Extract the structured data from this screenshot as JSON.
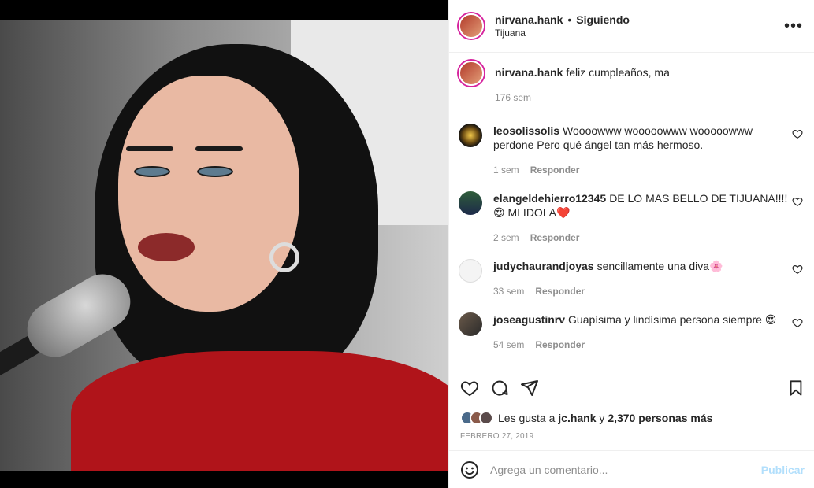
{
  "post": {
    "author": "nirvana.hank",
    "follow_status": "Siguiendo",
    "location": "Tijuana",
    "more_icon": "more-horizontal-icon"
  },
  "caption": {
    "user": "nirvana.hank",
    "text": "feliz cumpleaños, ma",
    "time": "176 sem"
  },
  "comments": [
    {
      "user": "leosolissolis",
      "text": "Woooowww wooooowww wooooowww perdone Pero qué ángel tan más hermoso.",
      "time": "1 sem",
      "reply": "Responder"
    },
    {
      "user": "elangeldehierro12345",
      "text": "DE LO MAS BELLO DE TIJUANA!!!! 😍 MI IDOLA❤️",
      "time": "2 sem",
      "reply": "Responder"
    },
    {
      "user": "judychaurandjoyas",
      "text": "sencillamente una diva🌸",
      "time": "33 sem",
      "reply": "Responder"
    },
    {
      "user": "joseagustinrv",
      "text": "Guapísima y lindísima persona siempre 😍",
      "time": "54 sem",
      "reply": "Responder"
    }
  ],
  "likes": {
    "prefix": "Les gusta a",
    "first_user": "jc.hank",
    "and": "y",
    "others": "2,370 personas más"
  },
  "date": "FEBRERO 27, 2019",
  "add_comment": {
    "placeholder": "Agrega un comentario...",
    "publish": "Publicar"
  },
  "colors": {
    "link_disabled": "#b2dffc",
    "secondary_text": "#8e8e8e",
    "primary_text": "#262626",
    "story_ring": "#d6249f"
  }
}
